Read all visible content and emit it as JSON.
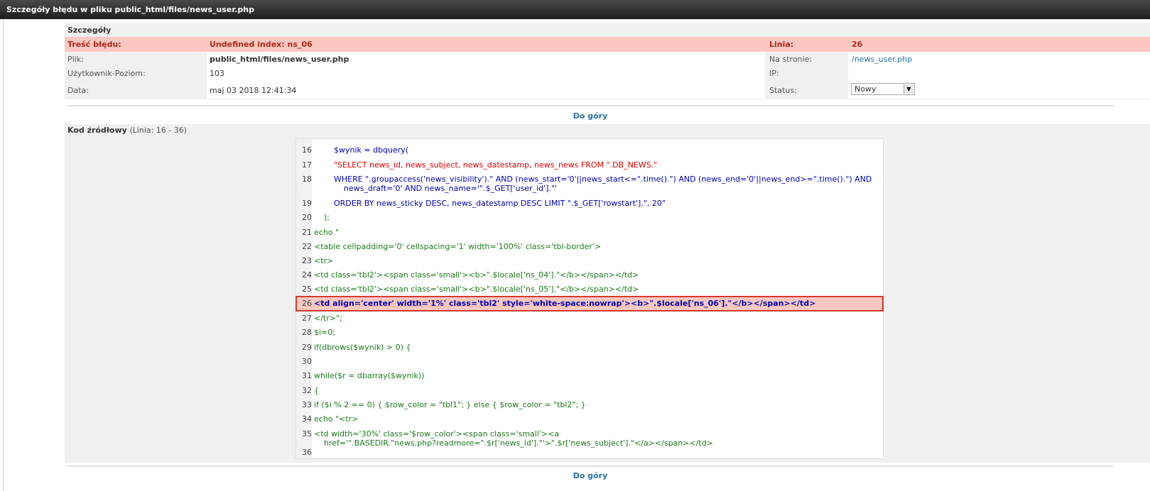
{
  "window": {
    "title": "Szczegóły błędu w pliku public_html/files/news_user.php"
  },
  "details": {
    "header": "Szczegóły",
    "error_label": "Treść błędu:",
    "error_value": "Undefined index: ns_06",
    "line_label": "Linia:",
    "line_value": "26",
    "file_label": "Plik:",
    "file_value": "public_html/files/news_user.php",
    "page_label": "Na stronie:",
    "page_value": "/news_user.php",
    "user_label": "Użytkownik-Poziom:",
    "user_value": "103",
    "ip_label": "IP:",
    "ip_value": "",
    "date_label": "Data:",
    "date_value": "maj 03 2018 12:41:34",
    "status_label": "Status:",
    "status_value": "Nowy"
  },
  "top_link": "Do góry",
  "source": {
    "header": "Kod źródłowy",
    "range": "(Linia: 16 - 36)"
  },
  "code_lines": [
    {
      "n": "16",
      "text": "        $wynik = dbquery("
    },
    {
      "n": "17",
      "text": "        \"SELECT news_id, news_subject, news_datestamp, news_news FROM \".DB_NEWS.\""
    },
    {
      "n": "18",
      "text": "        WHERE \".groupaccess('news_visibility').\" AND (news_start='0'||news_start<=\".time().\") AND (news_end='0'||news_end>=\".time().\") AND\n            news_draft='0' AND news_name='\".$_GET['user_id'].\"'"
    },
    {
      "n": "19",
      "text": "        ORDER BY news_sticky DESC, news_datestamp DESC LIMIT \".$_GET['rowstart'].\", 20\""
    },
    {
      "n": "20",
      "text": "    );"
    },
    {
      "n": "21",
      "text": "echo \""
    },
    {
      "n": "22",
      "text": "<table cellpadding='0' cellspacing='1' width='100%' class='tbl-border'>"
    },
    {
      "n": "23",
      "text": "<tr>"
    },
    {
      "n": "24",
      "text": "<td class='tbl2'><span class='small'><b>\".$locale['ns_04'].\"</b></span></td>"
    },
    {
      "n": "25",
      "text": "<td class='tbl2'><span class='small'><b>\".$locale['ns_05'].\"</b></span></td>"
    },
    {
      "n": "26",
      "text": "<td align='center' width='1%' class='tbl2' style='white-space:nowrap'><b>\".$locale['ns_06'].\"</b></span></td>"
    },
    {
      "n": "27",
      "text": "</tr>\";"
    },
    {
      "n": "28",
      "text": "$i=0;"
    },
    {
      "n": "29",
      "text": "if(dbrows($wynik) > 0) {"
    },
    {
      "n": "30",
      "text": ""
    },
    {
      "n": "31",
      "text": "while($r = dbarray($wynik))"
    },
    {
      "n": "32",
      "text": "{"
    },
    {
      "n": "33",
      "text": "if ($i % 2 == 0) { $row_color = \"tbl1\"; } else { $row_color = \"tbl2\"; }"
    },
    {
      "n": "34",
      "text": "echo \"<tr>"
    },
    {
      "n": "35",
      "text": "<td width='30%' class='$row_color'><span class='small'><a\n    href='\".BASEDIR.\"news.php?readmore=\".$r['news_id'].\"'>\".$r['news_subject'].\"</a></span></td>"
    },
    {
      "n": "36",
      "text": ""
    }
  ],
  "bottom_link": "Do góry",
  "highlight_line": "26",
  "colors": {
    "error_bg": "#fbc8c0",
    "error_text": "#b0281b",
    "link": "#2a6fa8"
  }
}
